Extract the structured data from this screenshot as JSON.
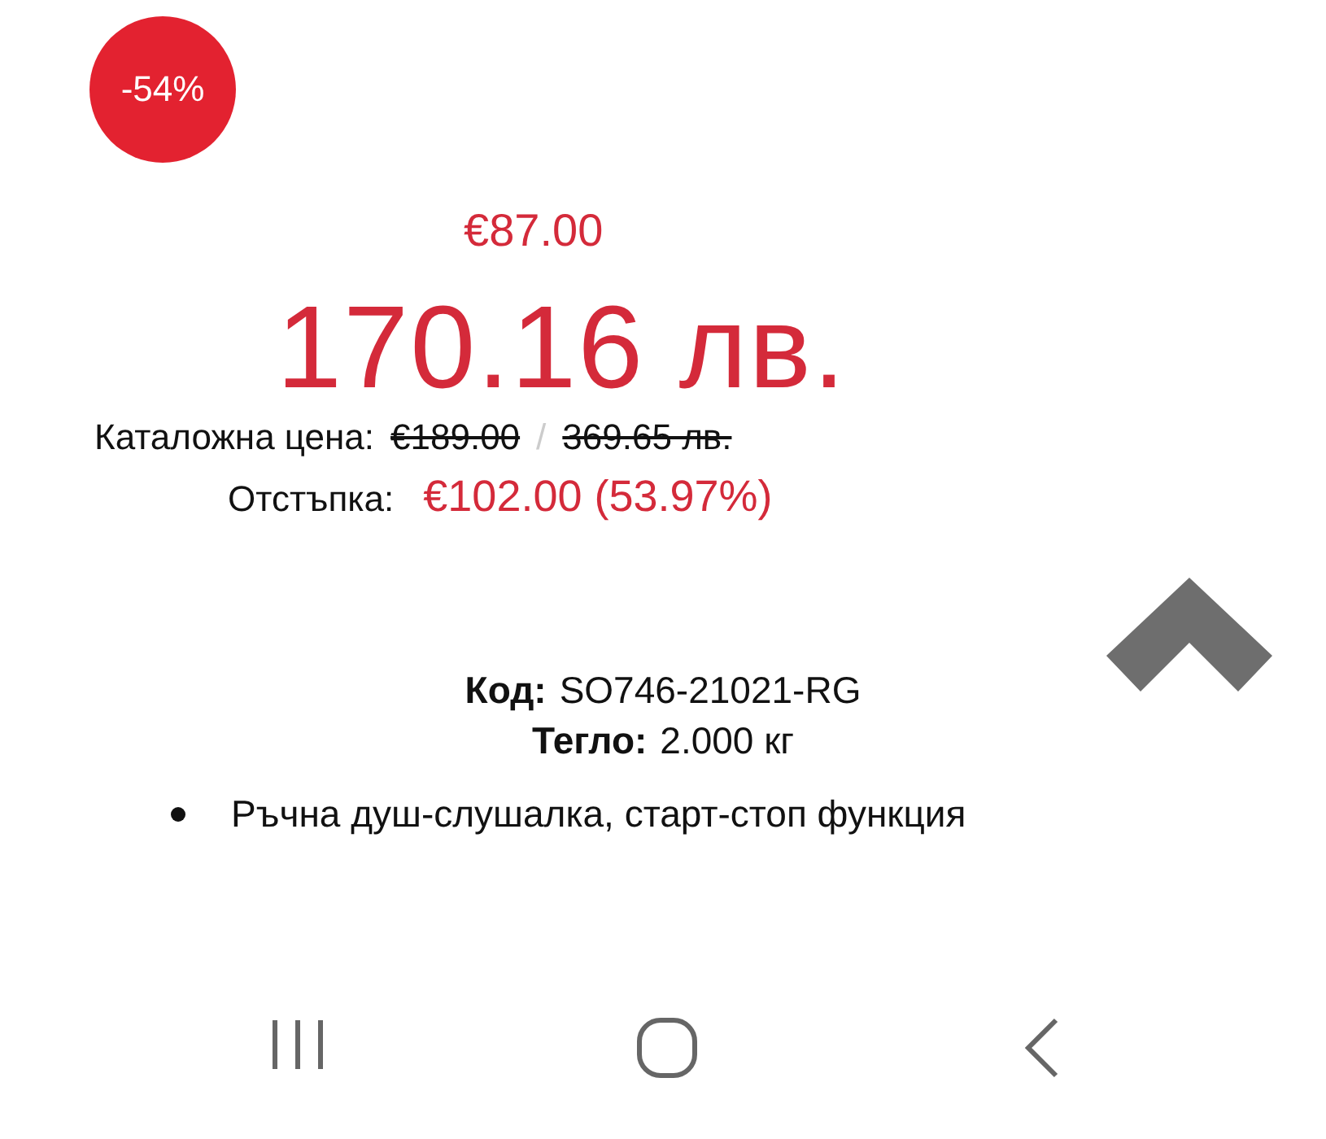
{
  "discount_badge": "-54%",
  "price_eur": "€87.00",
  "price_bgn": "170.16 лв.",
  "catalog_price": {
    "label": "Каталожна цена:",
    "eur": "€189.00",
    "separator": "/",
    "bgn": "369.65 лв."
  },
  "discount": {
    "label": "Отстъпка:",
    "value": "€102.00 (53.97%)"
  },
  "details": [
    {
      "label": "Код:",
      "value": "SO746-21021-RG"
    },
    {
      "label": "Тегло:",
      "value": "2.000 кг"
    }
  ],
  "features": [
    "Ръчна душ-слушалка, старт-стоп функция"
  ],
  "nav_bar": [
    {
      "kind": "recents"
    },
    {
      "kind": "home"
    },
    {
      "kind": "back"
    }
  ]
}
